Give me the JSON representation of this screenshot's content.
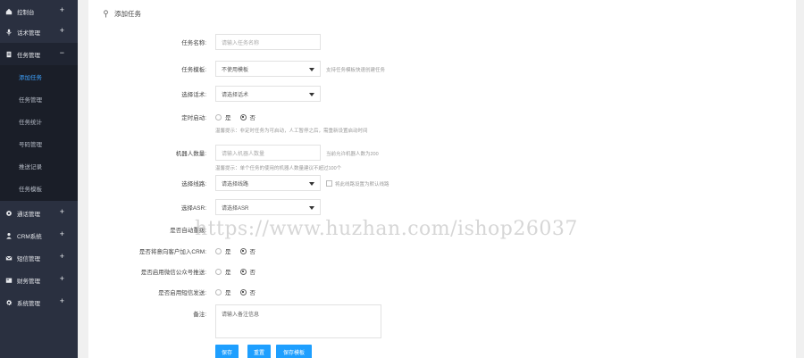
{
  "sidebar": {
    "items": [
      {
        "label": "控制台",
        "icon": "home-icon",
        "toggle": "+"
      },
      {
        "label": "话术管理",
        "icon": "microphone-icon",
        "toggle": "+"
      },
      {
        "label": "任务管理",
        "icon": "document-icon",
        "toggle": "−"
      },
      {
        "label": "通话管理",
        "icon": "gear-icon",
        "toggle": "+"
      },
      {
        "label": "CRM系统",
        "icon": "user-icon",
        "toggle": "+"
      },
      {
        "label": "短信管理",
        "icon": "mail-icon",
        "toggle": "+"
      },
      {
        "label": "财务管理",
        "icon": "wallet-icon",
        "toggle": "+"
      },
      {
        "label": "系统管理",
        "icon": "gear-icon",
        "toggle": "+"
      }
    ],
    "subitems": [
      {
        "label": "添加任务",
        "active": true
      },
      {
        "label": "任务管理",
        "active": false
      },
      {
        "label": "任务统计",
        "active": false
      },
      {
        "label": "号码管理",
        "active": false
      },
      {
        "label": "推送记录",
        "active": false
      },
      {
        "label": "任务模板",
        "active": false
      }
    ]
  },
  "header": {
    "title": "添加任务",
    "icon": "pin-icon"
  },
  "form": {
    "task_name": {
      "label": "任务名称:",
      "placeholder": "请输入任务名称"
    },
    "task_template": {
      "label": "任务模板:",
      "value": "不使用模板",
      "hint": "支持任务模板快速创建任务"
    },
    "select_scenario": {
      "label": "选择话术:",
      "value": "请选择话术"
    },
    "timed_start": {
      "label": "定时启动:",
      "options": [
        "是",
        "否"
      ],
      "selected": "否",
      "hint": "温馨提示：非定时任务为可启动，人工暂停之后，需重新设置启动时间"
    },
    "robot_count": {
      "label": "机器人数量:",
      "placeholder": "请输入机器人数量",
      "hint": "当前允许机器人数为200",
      "hint2": "温馨提示：单个任务的使用的机器人数量建议不超过100个"
    },
    "select_line": {
      "label": "选择线路:",
      "value": "请选择线路",
      "checkbox_label": "将此线路设置为默认线路"
    },
    "select_asr": {
      "label": "选择ASR:",
      "value": "请选择ASR"
    },
    "auto_redial": {
      "label": "是否自动重拨:"
    },
    "add_crm": {
      "label": "是否将意向客户加入CRM:",
      "options": [
        "是",
        "否"
      ],
      "selected": "否"
    },
    "wechat_push": {
      "label": "是否启用微信公众号推送:",
      "options": [
        "是",
        "否"
      ],
      "selected": "否"
    },
    "sms_send": {
      "label": "是否启用短信发送:",
      "options": [
        "是",
        "否"
      ],
      "selected": "否"
    },
    "remark": {
      "label": "备注:",
      "placeholder": "请输入备注信息"
    }
  },
  "buttons": {
    "submit": "保存",
    "reset": "重置",
    "save_template": "保存模板"
  },
  "watermark": "https://www.huzhan.com/ishop26037",
  "colors": {
    "sidebar_bg": "#2a3040",
    "accent": "#1e9fff",
    "active_link": "#3fa3ff"
  }
}
